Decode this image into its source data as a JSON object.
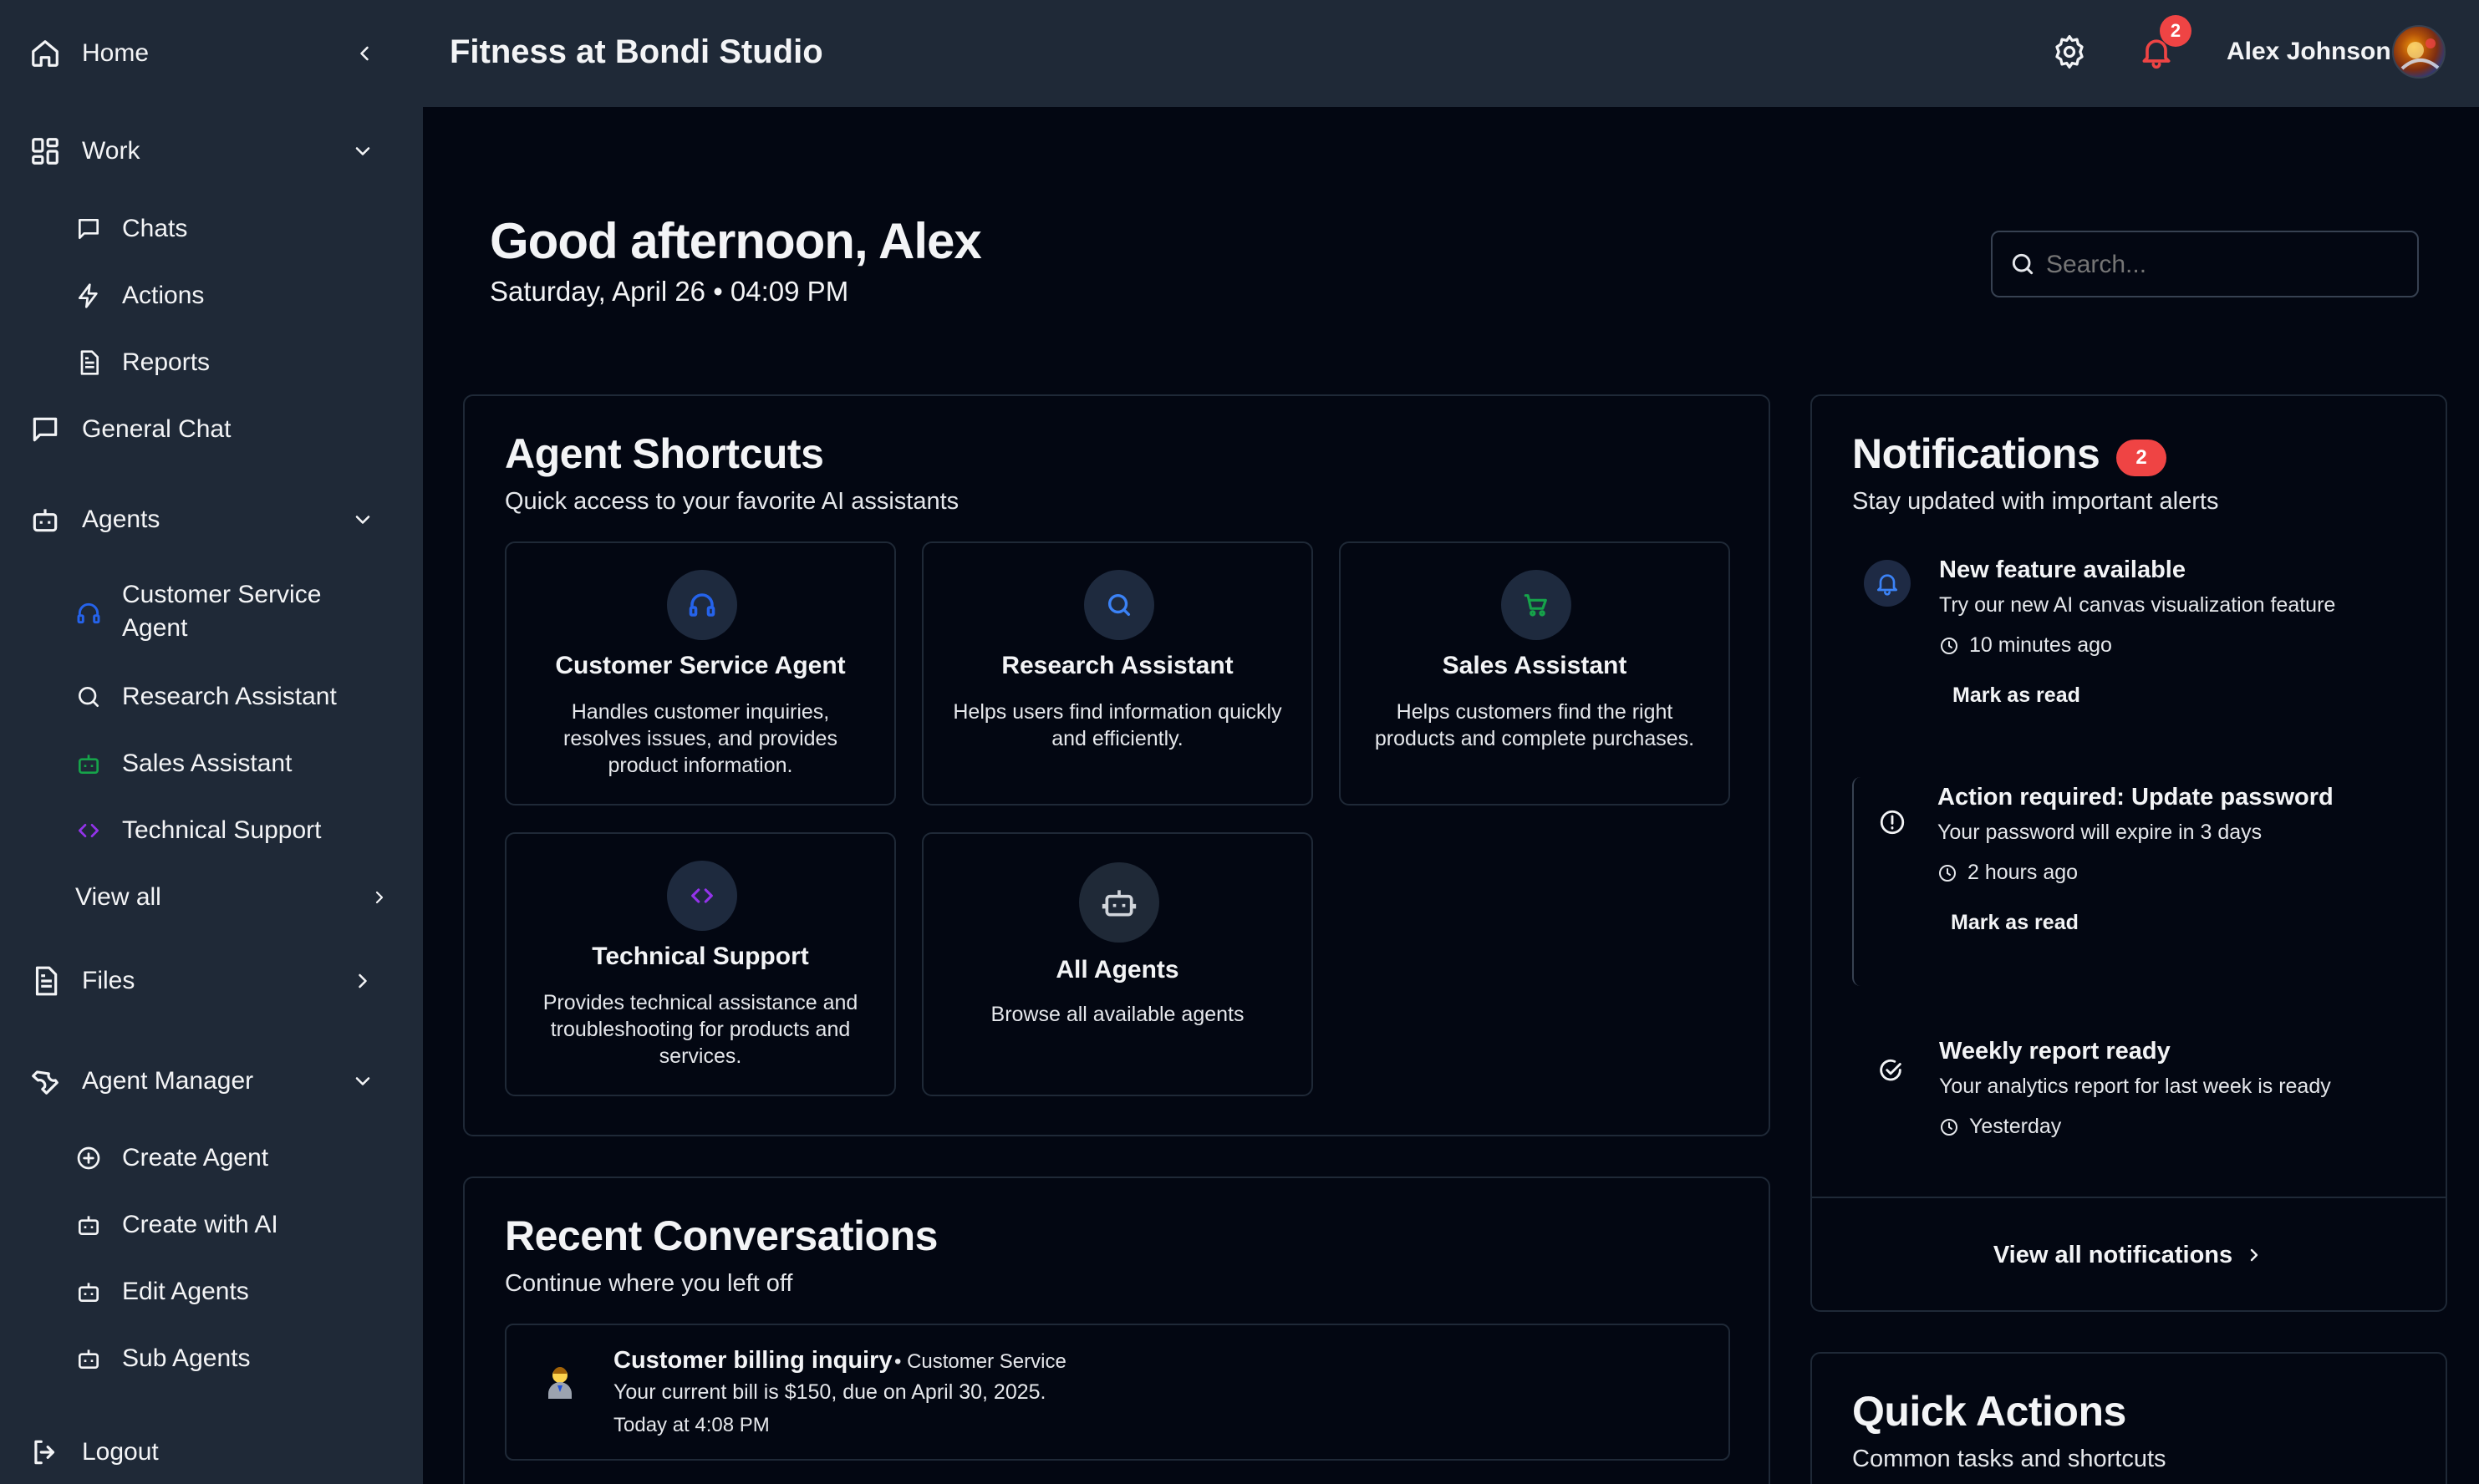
{
  "app": {
    "title": "Fitness at Bondi Studio"
  },
  "user": {
    "name": "Alex Johnson",
    "notification_count": "2"
  },
  "sidebar": {
    "home": "Home",
    "work": "Work",
    "chats": "Chats",
    "actions": "Actions",
    "reports": "Reports",
    "general_chat": "General Chat",
    "agents": "Agents",
    "agent_items": [
      "Customer Service Agent",
      "Research Assistant",
      "Sales Assistant",
      "Technical Support"
    ],
    "view_all": "View all",
    "files": "Files",
    "agent_manager": "Agent Manager",
    "manager_items": [
      "Create Agent",
      "Create with AI",
      "Edit Agents",
      "Sub Agents"
    ],
    "logout": "Logout"
  },
  "greeting": {
    "title": "Good afternoon, Alex",
    "datetime": "Saturday, April 26 • 04:09 PM"
  },
  "search": {
    "placeholder": "Search..."
  },
  "shortcuts": {
    "title": "Agent Shortcuts",
    "subtitle": "Quick access to your favorite AI assistants",
    "agents": [
      {
        "name": "Customer Service Agent",
        "desc": "Handles customer inquiries, resolves issues, and provides product information.",
        "icon": "headset-icon",
        "color": "#2563eb"
      },
      {
        "name": "Research Assistant",
        "desc": "Helps users find information quickly and efficiently.",
        "icon": "search-icon",
        "color": "#3b82f6"
      },
      {
        "name": "Sales Assistant",
        "desc": "Helps customers find the right products and complete purchases.",
        "icon": "cart-icon",
        "color": "#16a34a"
      },
      {
        "name": "Technical Support",
        "desc": "Provides technical assistance and troubleshooting for products and services.",
        "icon": "code-icon",
        "color": "#9333ea"
      }
    ],
    "all_agents": {
      "name": "All Agents",
      "desc": "Browse all available agents"
    }
  },
  "recent": {
    "title": "Recent Conversations",
    "subtitle": "Continue where you left off",
    "items": [
      {
        "title": "Customer billing inquiry",
        "tag": "• Customer Service",
        "message": "Your current bill is $150, due on April 30, 2025.",
        "time": "Today at 4:08 PM"
      }
    ]
  },
  "notifications": {
    "title": "Notifications",
    "count": "2",
    "subtitle": "Stay updated with important alerts",
    "items": [
      {
        "title": "New feature available",
        "message": "Try our new AI canvas visualization feature",
        "time": "10 minutes ago",
        "action": "Mark as read",
        "icon": "bell-icon"
      },
      {
        "title": "Action required: Update password",
        "message": "Your password will expire in 3 days",
        "time": "2 hours ago",
        "action": "Mark as read",
        "icon": "alert-circle-icon"
      },
      {
        "title": "Weekly report ready",
        "message": "Your analytics report for last week is ready",
        "time": "Yesterday",
        "icon": "check-circle-icon"
      }
    ],
    "view_all": "View all notifications"
  },
  "quick_actions": {
    "title": "Quick Actions",
    "subtitle": "Common tasks and shortcuts"
  },
  "colors": {
    "accent_red": "#ef4444",
    "bg": "#030712",
    "panel": "#1f2937"
  }
}
